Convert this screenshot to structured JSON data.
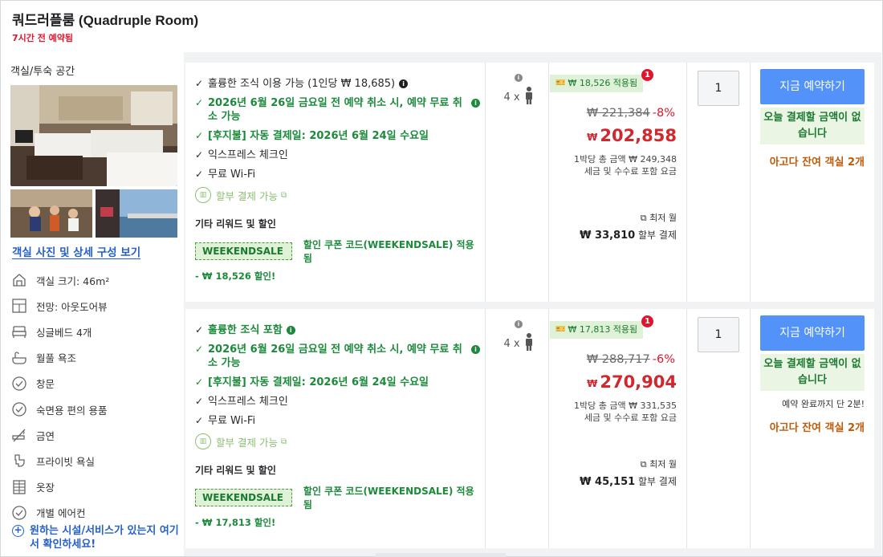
{
  "header": {
    "room_title": "쿼드러플룸 (Quadruple Room)",
    "booked_ago": "7시간 전 예약됨"
  },
  "left": {
    "section_title": "객실/투숙 공간",
    "photo_link": "객실 사진 및 상세 구성 보기",
    "features": [
      {
        "icon": "room-size-icon",
        "label": "객실 크기: 46m²"
      },
      {
        "icon": "window-view-icon",
        "label": "전망: 아웃도어뷰"
      },
      {
        "icon": "bed-icon",
        "label": "싱글베드 4개"
      },
      {
        "icon": "bathtub-icon",
        "label": "월풀 욕조"
      },
      {
        "icon": "check-circle-icon",
        "label": "창문"
      },
      {
        "icon": "check-circle-icon",
        "label": "숙면용 편의 용품"
      },
      {
        "icon": "no-smoking-icon",
        "label": "금연"
      },
      {
        "icon": "shower-icon",
        "label": "프라이빗 욕실"
      },
      {
        "icon": "closet-icon",
        "label": "옷장"
      },
      {
        "icon": "check-circle-icon",
        "label": "개별 에어컨"
      }
    ],
    "check_link": "원하는 시설/서비스가 있는지 여기서 확인하세요!"
  },
  "offers": [
    {
      "benefits": [
        {
          "text": "훌륭한 조식 이용 가능 (1인당 ₩ 18,685)",
          "style": "normal",
          "info": true
        },
        {
          "text": "2026년 6월 26일 금요일 전 예약 취소 시, 예약 무료 취소 가능",
          "style": "green",
          "info": true
        },
        {
          "text": "[후지불] 자동 결제일: 2026년 6월 24일 수요일",
          "style": "green",
          "info": false
        },
        {
          "text": "익스프레스 체크인",
          "style": "normal",
          "info": false
        },
        {
          "text": "무료 Wi-Fi",
          "style": "normal",
          "info": false
        }
      ],
      "installment": "할부 결제 가능",
      "other_title": "기타 리워드 및 할인",
      "coupon_tag": "WEEKENDSALE",
      "coupon_text": "할인 쿠폰 코드(WEEKENDSALE) 적용됨",
      "discount_line": "- ₩ 18,526 할인!",
      "occupancy": "4 x",
      "promo_badge": "₩ 18,526 적용됨",
      "promo_count": "1",
      "original_price": "₩ 221,384",
      "discount_pct": "-8%",
      "currency": "₩",
      "final_price": "202,858",
      "per_night_1": "1박당 총 금액 ₩ 249,348",
      "per_night_2": "세금 및 수수료 포함 요금",
      "monthly_label": "최저 월",
      "monthly_amount": "₩ 33,810",
      "monthly_suffix": "할부 결제",
      "quantity": "1",
      "book_label": "지금 예약하기",
      "no_pay": "오늘 결제할 금액이 없습니다",
      "urgent": "",
      "left_rooms": "아고다 잔여 객실 2개"
    },
    {
      "benefits": [
        {
          "text": "훌륭한 조식 포함",
          "style": "normal",
          "info": true
        },
        {
          "text": "2026년 6월 26일 금요일 전 예약 취소 시, 예약 무료 취소 가능",
          "style": "green",
          "info": true
        },
        {
          "text": "[후지불] 자동 결제일: 2026년 6월 24일 수요일",
          "style": "green",
          "info": false
        },
        {
          "text": "익스프레스 체크인",
          "style": "normal",
          "info": false
        },
        {
          "text": "무료 Wi-Fi",
          "style": "normal",
          "info": false
        }
      ],
      "installment": "할부 결제 가능",
      "other_title": "기타 리워드 및 할인",
      "coupon_tag": "WEEKENDSALE",
      "coupon_text": "할인 쿠폰 코드(WEEKENDSALE) 적용됨",
      "discount_line": "- ₩ 17,813 할인!",
      "occupancy": "4 x",
      "promo_badge": "₩ 17,813 적용됨",
      "promo_count": "1",
      "original_price": "₩ 288,717",
      "discount_pct": "-6%",
      "currency": "₩",
      "final_price": "270,904",
      "per_night_1": "1박당 총 금액 ₩ 331,535",
      "per_night_2": "세금 및 수수료 포함 요금",
      "monthly_label": "최저 월",
      "monthly_amount": "₩ 45,151",
      "monthly_suffix": "할부 결제",
      "quantity": "1",
      "book_label": "지금 예약하기",
      "no_pay": "오늘 결제할 금액이 없습니다",
      "urgent": "예약 완료까지 단 2분!",
      "left_rooms": "아고다 잔여 객실 2개"
    }
  ],
  "colors": {
    "accent_blue": "#5392f9",
    "price_red": "#d1282e",
    "green": "#1b8a3a",
    "orange": "#c05b0a"
  }
}
